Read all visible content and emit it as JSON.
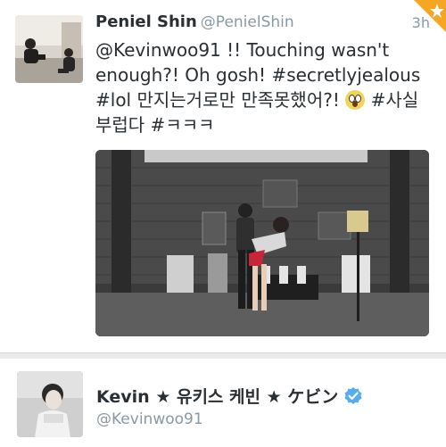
{
  "tweet": {
    "author_name": "Peniel Shin",
    "author_handle": "@PenielShin",
    "time": "3h",
    "text_before_emoji": "@Kevinwoo91 !! Touching wasn't enough?! Oh gosh! #secretlyjealous #lol 만지는거로만 만족못했어?! ",
    "text_after_emoji": " #사실 부럽다 #ㅋㅋㅋ",
    "emoji_icon": "fearful-face-emoji",
    "favorite_icon": "star-icon",
    "favorite_color": "#f5a623"
  },
  "profile": {
    "display_name": "Kevin ★ 유키스 케빈 ★ ケビン",
    "handle": "@Kevinwoo91",
    "verified_icon": "verified-badge-icon",
    "verified_color": "#55acee"
  },
  "colors": {
    "text": "#292f33",
    "secondary_text": "#8899a6",
    "divider": "#e8eaeb"
  }
}
